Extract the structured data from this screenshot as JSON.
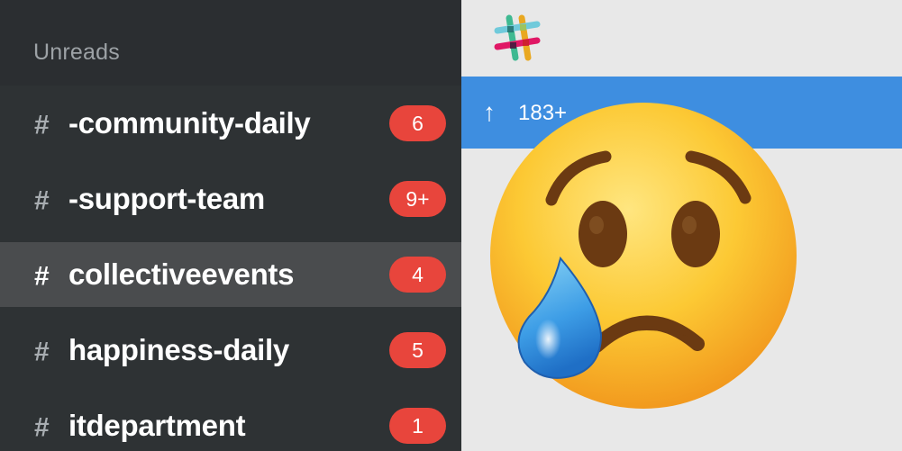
{
  "sidebar": {
    "title": "Unreads",
    "channels": [
      {
        "hash": "#",
        "name": "-community-daily",
        "badge": "6"
      },
      {
        "hash": "#",
        "name": "-support-team",
        "badge": "9+"
      },
      {
        "hash": "#",
        "name": "collectiveevents",
        "badge": "4",
        "active": true
      },
      {
        "hash": "#",
        "name": "happiness-daily",
        "badge": "5"
      },
      {
        "hash": "#",
        "name": "itdepartment",
        "badge": "1"
      }
    ]
  },
  "main": {
    "banner": {
      "arrow": "↑",
      "count": "183+"
    },
    "logo_icon": "slack-hash-logo",
    "emoji_icon": "crying-face-emoji"
  },
  "colors": {
    "sidebar_bg": "#2e3234",
    "active_row": "#4a4c4e",
    "badge": "#e8453c",
    "banner": "#3e8ee0",
    "main_bg": "#e8e8e8"
  }
}
